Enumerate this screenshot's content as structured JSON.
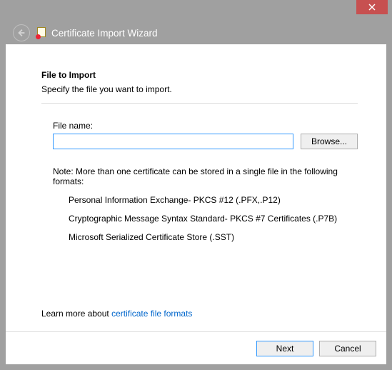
{
  "window": {
    "wizard_title": "Certificate Import Wizard"
  },
  "page": {
    "heading": "File to Import",
    "subheading": "Specify the file you want to import.",
    "file_label": "File name:",
    "file_value": "",
    "browse_label": "Browse...",
    "note": "Note:  More than one certificate can be stored in a single file in the following formats:",
    "formats": [
      "Personal Information Exchange- PKCS #12 (.PFX,.P12)",
      "Cryptographic Message Syntax Standard- PKCS #7 Certificates (.P7B)",
      "Microsoft Serialized Certificate Store (.SST)"
    ],
    "learn_prefix": "Learn more about ",
    "learn_link": "certificate file formats"
  },
  "buttons": {
    "next": "Next",
    "cancel": "Cancel"
  }
}
